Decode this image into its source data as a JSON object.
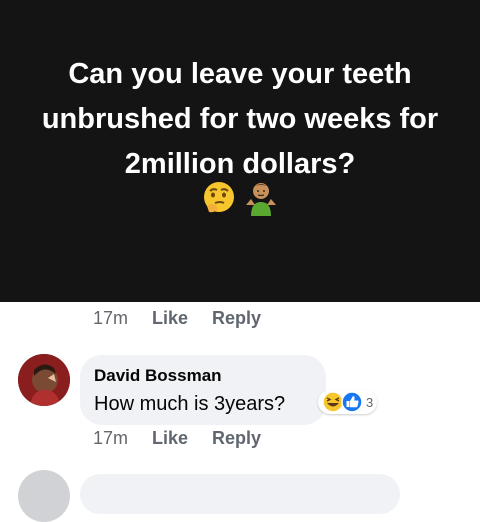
{
  "post": {
    "question_lines": [
      "Can you leave your teeth",
      "unbrushed for two weeks for",
      "2million dollars?"
    ],
    "emojis": [
      "thinking-face-emoji",
      "person-shrugging-emoji"
    ]
  },
  "post_meta": {
    "time": "17m",
    "like_label": "Like",
    "reply_label": "Reply"
  },
  "comment": {
    "author": "David Bossman",
    "text": "How much  is 3years?",
    "reactions": {
      "icons": [
        "haha-icon",
        "like-icon"
      ],
      "count": "3"
    },
    "meta": {
      "time": "17m",
      "like_label": "Like",
      "reply_label": "Reply"
    }
  }
}
